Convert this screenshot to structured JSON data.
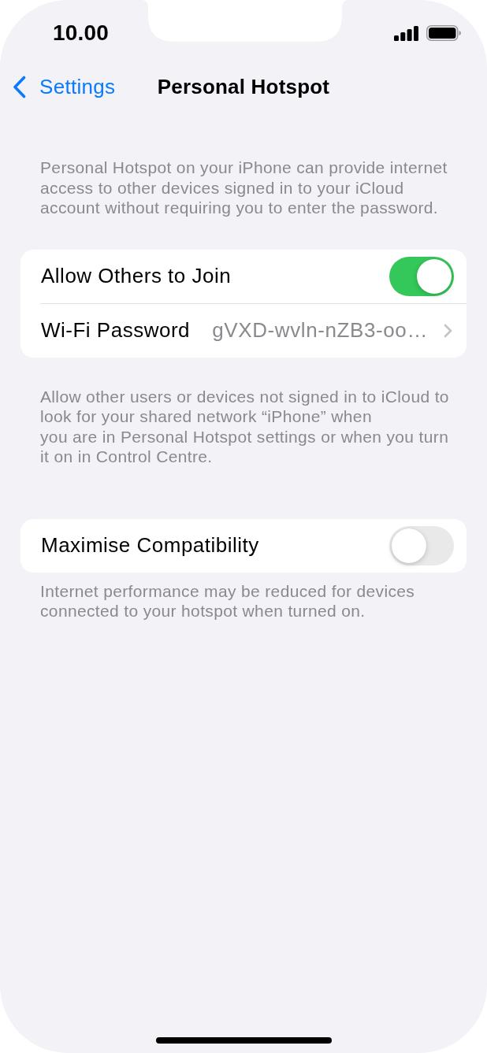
{
  "status_bar": {
    "time": "10.00"
  },
  "nav_bar": {
    "back_label": "Settings",
    "title": "Personal Hotspot"
  },
  "intro_note": "Personal Hotspot on your iPhone can provide internet access to other devices signed in to your iCloud account without requiring you to enter the password.",
  "groups": [
    {
      "rows": [
        {
          "kind": "toggle",
          "label": "Allow Others to Join",
          "on": true
        },
        {
          "kind": "disclosure",
          "label": "Wi-Fi Password",
          "value": "gVXD-wvln-nZB3-oo…"
        }
      ],
      "footer": "Allow other users or devices not signed in to iCloud to look for your shared network “iPhone” when\nyou are in Personal Hotspot settings or when you turn it on in Control Centre."
    },
    {
      "rows": [
        {
          "kind": "toggle",
          "label": "Maximise Compatibility",
          "on": false
        }
      ],
      "footer": "Internet performance may be reduced for devices connected to your hotspot when turned on."
    }
  ]
}
